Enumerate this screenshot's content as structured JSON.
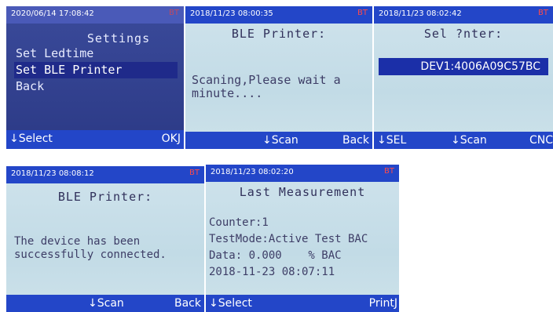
{
  "screen1": {
    "timestamp": "2020/06/14 17:08:42",
    "indicator": "BT",
    "title": "Settings",
    "menu": [
      "Set Ledtime",
      "Set BLE Printer",
      "Back"
    ],
    "selected_index": 1,
    "left_softkey": "↓Select",
    "right_softkey": "OKJ"
  },
  "screen2": {
    "timestamp": "2018/11/23 08:00:35",
    "indicator": "BT",
    "title": "BLE Printer:",
    "message": "Scaning,Please wait a\nminute....",
    "center_softkey": "↓Scan",
    "right_softkey": "Back"
  },
  "screen3": {
    "timestamp": "2018/11/23 08:02:42",
    "indicator": "BT",
    "title": "Sel  ?nter:",
    "device": "DEV1:4006A09C57BC",
    "left_softkey": "↓SEL",
    "center_softkey": "↓Scan",
    "right_softkey": "CNC"
  },
  "screen4": {
    "timestamp": "2018/11/23 08:08:12",
    "indicator": "BT",
    "title": "BLE Printer:",
    "message": "The device has been\nsuccessfully connected.",
    "center_softkey": "↓Scan",
    "right_softkey": "Back"
  },
  "screen5": {
    "timestamp": "2018/11/23 08:02:20",
    "indicator": "BT",
    "title": "Last Measurement",
    "lines": [
      "Counter:1",
      "TestMode:Active Test BAC",
      "Data: 0.000    % BAC",
      "2018-11-23 08:07:11"
    ],
    "left_softkey": "↓Select",
    "right_softkey": "PrintJ"
  }
}
